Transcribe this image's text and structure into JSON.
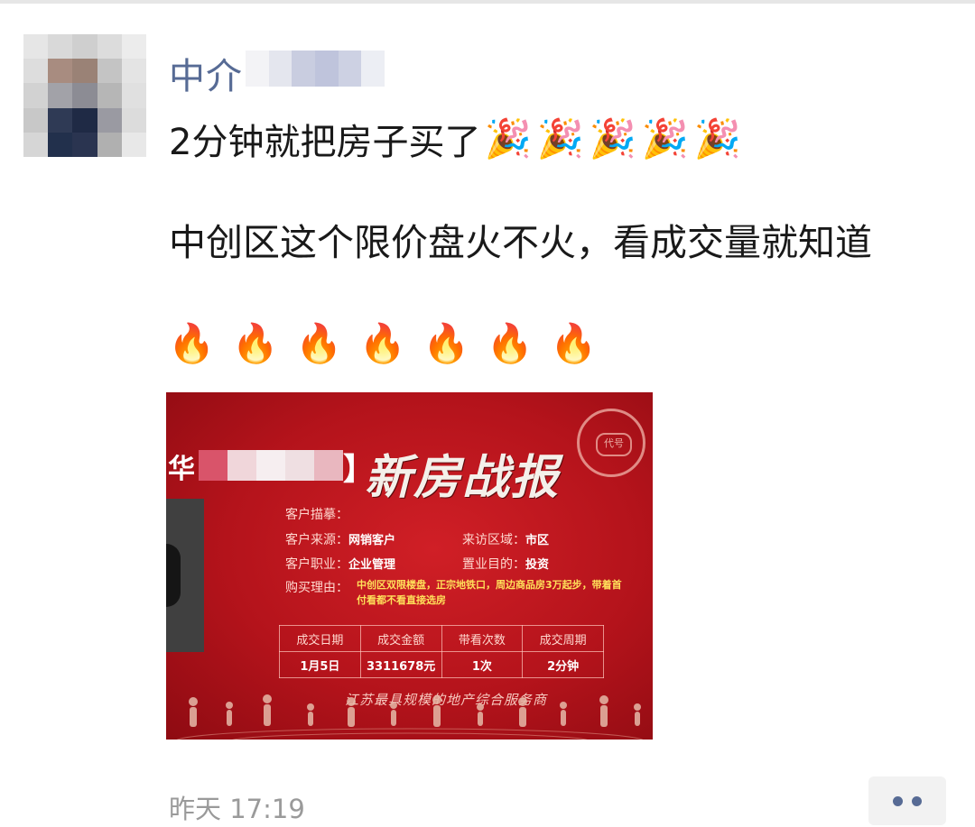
{
  "post": {
    "author": "中介",
    "text_line1": "2分钟就把房子买了",
    "text_body": "中创区这个限价盘火不火，看成交量就知道",
    "party_emoji": [
      "🎉",
      "🎉",
      "🎉",
      "🎉",
      "🎉"
    ],
    "fire_emoji": [
      "🔥",
      "🔥",
      "🔥",
      "🔥",
      "🔥",
      "🔥",
      "🔥"
    ],
    "time": "昨天 17:19"
  },
  "poster": {
    "brand_prefix": "华",
    "brand_suffix": "】",
    "headline": "新房战报",
    "seal_text": "代号",
    "customer_profile_label": "客户描摹：",
    "source_label": "客户来源：",
    "source_value": "网销客户",
    "visit_area_label": "来访区域：",
    "visit_area_value": "市区",
    "occupation_label": "客户职业：",
    "occupation_value": "企业管理",
    "purpose_label": "置业目的：",
    "purpose_value": "投资",
    "reason_label": "购买理由：",
    "reason_value": "中创区双限楼盘，正宗地铁口，周边商品房3万起步，带着首付看都不看直接选房",
    "table_headers": [
      "成交日期",
      "成交金额",
      "带看次数",
      "成交周期"
    ],
    "table_values": [
      "1月5日",
      "3311678元",
      "1次",
      "2分钟"
    ],
    "slogan": "江苏最具规模的地产综合服务商"
  },
  "colors": {
    "name_blue": "#576b95",
    "poster_red": "#c0141c",
    "highlight_yellow": "#ffe05a"
  },
  "icons": {
    "more": "more-dots-icon",
    "party": "party-popper-icon",
    "fire": "fire-icon"
  }
}
